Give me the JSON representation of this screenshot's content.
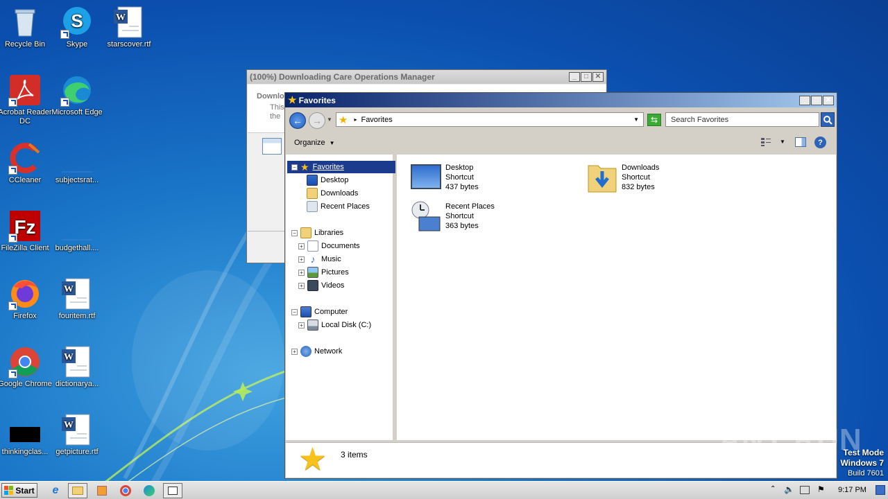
{
  "desktop": {
    "icons": [
      {
        "label": "Recycle Bin"
      },
      {
        "label": "Skype"
      },
      {
        "label": "starscover.rtf"
      },
      {
        "label": "Acrobat Reader DC"
      },
      {
        "label": "Microsoft Edge"
      },
      {
        "label": "CCleaner"
      },
      {
        "label": "subjectsrat..."
      },
      {
        "label": "FileZilla Client"
      },
      {
        "label": "budgethall...."
      },
      {
        "label": "Firefox"
      },
      {
        "label": "fouritem.rtf"
      },
      {
        "label": "Google Chrome"
      },
      {
        "label": "dictionarya..."
      },
      {
        "label": "thinkingclas..."
      },
      {
        "label": "getpicture.rtf"
      }
    ]
  },
  "download_window": {
    "title": "(100%) Downloading Care Operations Manager",
    "heading": "Downlo",
    "line1": "This",
    "line2": "the"
  },
  "explorer": {
    "title": "Favorites",
    "address": "Favorites",
    "search_placeholder": "Search Favorites",
    "organize_label": "Organize",
    "nav": {
      "favorites": "Favorites",
      "desktop": "Desktop",
      "downloads": "Downloads",
      "recent_places": "Recent Places",
      "libraries": "Libraries",
      "documents": "Documents",
      "music": "Music",
      "pictures": "Pictures",
      "videos": "Videos",
      "computer": "Computer",
      "local_disk": "Local Disk (C:)",
      "network": "Network"
    },
    "items": [
      {
        "name": "Desktop",
        "type": "Shortcut",
        "size": "437 bytes"
      },
      {
        "name": "Downloads",
        "type": "Shortcut",
        "size": "832 bytes"
      },
      {
        "name": "Recent Places",
        "type": "Shortcut",
        "size": "363 bytes"
      }
    ],
    "status": "3 items"
  },
  "watermark": {
    "text": "ANY RUN",
    "test_mode": "Test Mode",
    "os": "Windows 7",
    "build": "Build 7601"
  },
  "taskbar": {
    "start_label": "Start",
    "clock": "9:17 PM"
  },
  "colors": {
    "accent": "#1a4fb3",
    "selection": "#1c3b8c",
    "title_active": "#0a246a"
  }
}
